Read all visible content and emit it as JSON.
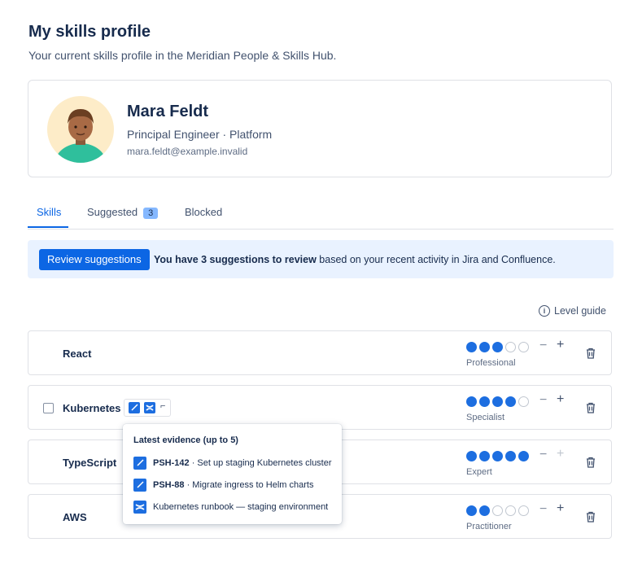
{
  "page": {
    "title": "My skills profile",
    "subtitle": "Your current skills profile in the Meridian People & Skills Hub."
  },
  "profile": {
    "name": "Mara Feldt",
    "role": "Principal Engineer · Platform",
    "email": "mara.feldt@example.invalid"
  },
  "tabs": [
    {
      "label": "Skills",
      "active": true
    },
    {
      "label": "Suggested",
      "badge": "3"
    },
    {
      "label": "Blocked"
    }
  ],
  "banner": {
    "button_label": "Review suggestions",
    "bold_text": "You have 3 suggestions to review",
    "rest_text": " based on your recent activity in Jira and Confluence."
  },
  "level_guide": "Level guide",
  "icons": {
    "info": "info-icon",
    "trash": "trash-icon",
    "jira": "jira-icon",
    "confluence": "confluence-icon",
    "page": "document-icon"
  },
  "colors": {
    "accent": "#0c66e4",
    "dot_filled": "#1d6ee0",
    "banner_bg": "#e9f2ff"
  },
  "skills": [
    {
      "name": "React",
      "level": 3,
      "max": 5,
      "level_label": "Professional"
    },
    {
      "name": "Kubernetes",
      "level": 4,
      "max": 5,
      "level_label": "Specialist"
    },
    {
      "name": "TypeScript",
      "level": 5,
      "max": 5,
      "level_label": "Expert"
    },
    {
      "name": "AWS",
      "level": 2,
      "max": 5,
      "level_label": "Practitioner"
    }
  ],
  "evidence": {
    "title": "Latest evidence (up to 5)",
    "items": [
      {
        "key": "PSH-142",
        "text": " · Set up staging Kubernetes cluster",
        "icon": "jira-icon"
      },
      {
        "key": "PSH-88",
        "text": " · Migrate ingress to Helm charts",
        "icon": "jira-icon"
      },
      {
        "key": "",
        "text": "Kubernetes runbook — staging environment",
        "icon": "confluence-icon"
      }
    ]
  }
}
